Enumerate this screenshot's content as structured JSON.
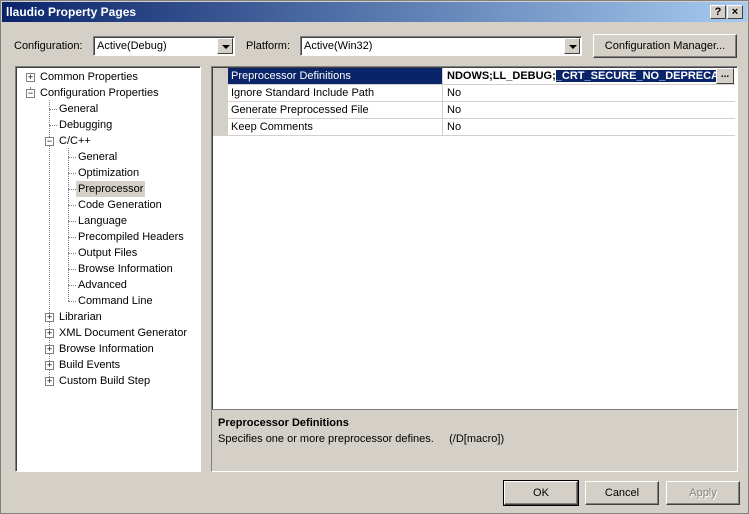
{
  "window": {
    "title": "llaudio Property Pages",
    "help_glyph": "?",
    "close_glyph": "×"
  },
  "config_bar": {
    "configuration_label": "Configuration:",
    "configuration_value": "Active(Debug)",
    "platform_label": "Platform:",
    "platform_value": "Active(Win32)",
    "manager_button": "Configuration Manager..."
  },
  "tree": {
    "common_properties": "Common Properties",
    "configuration_properties": "Configuration Properties",
    "general": "General",
    "debugging": "Debugging",
    "cpp": "C/C++",
    "cpp_children": [
      "General",
      "Optimization",
      "Preprocessor",
      "Code Generation",
      "Language",
      "Precompiled Headers",
      "Output Files",
      "Browse Information",
      "Advanced",
      "Command Line"
    ],
    "librarian": "Librarian",
    "xml_doc_generator": "XML Document Generator",
    "browse_information": "Browse Information",
    "build_events": "Build Events",
    "custom_build_step": "Custom Build Step",
    "selected": "Preprocessor",
    "expand_glyph": "+",
    "collapse_glyph": "−"
  },
  "grid": {
    "rows": [
      {
        "name": "Preprocessor Definitions",
        "value_plain": "NDOWS;LL_DEBUG;",
        "value_highlight": "_CRT_SECURE_NO_DEPRECATE",
        "ellipsis": "..."
      },
      {
        "name": "Ignore Standard Include Path",
        "value": "No"
      },
      {
        "name": "Generate Preprocessed File",
        "value": "No"
      },
      {
        "name": "Keep Comments",
        "value": "No"
      }
    ]
  },
  "description": {
    "title": "Preprocessor Definitions",
    "text": "Specifies one or more preprocessor defines.     (/D[macro])"
  },
  "buttons": {
    "ok": "OK",
    "cancel": "Cancel",
    "apply": "Apply"
  },
  "colors": {
    "selection": "#0a246a",
    "face": "#d4d0c8"
  }
}
